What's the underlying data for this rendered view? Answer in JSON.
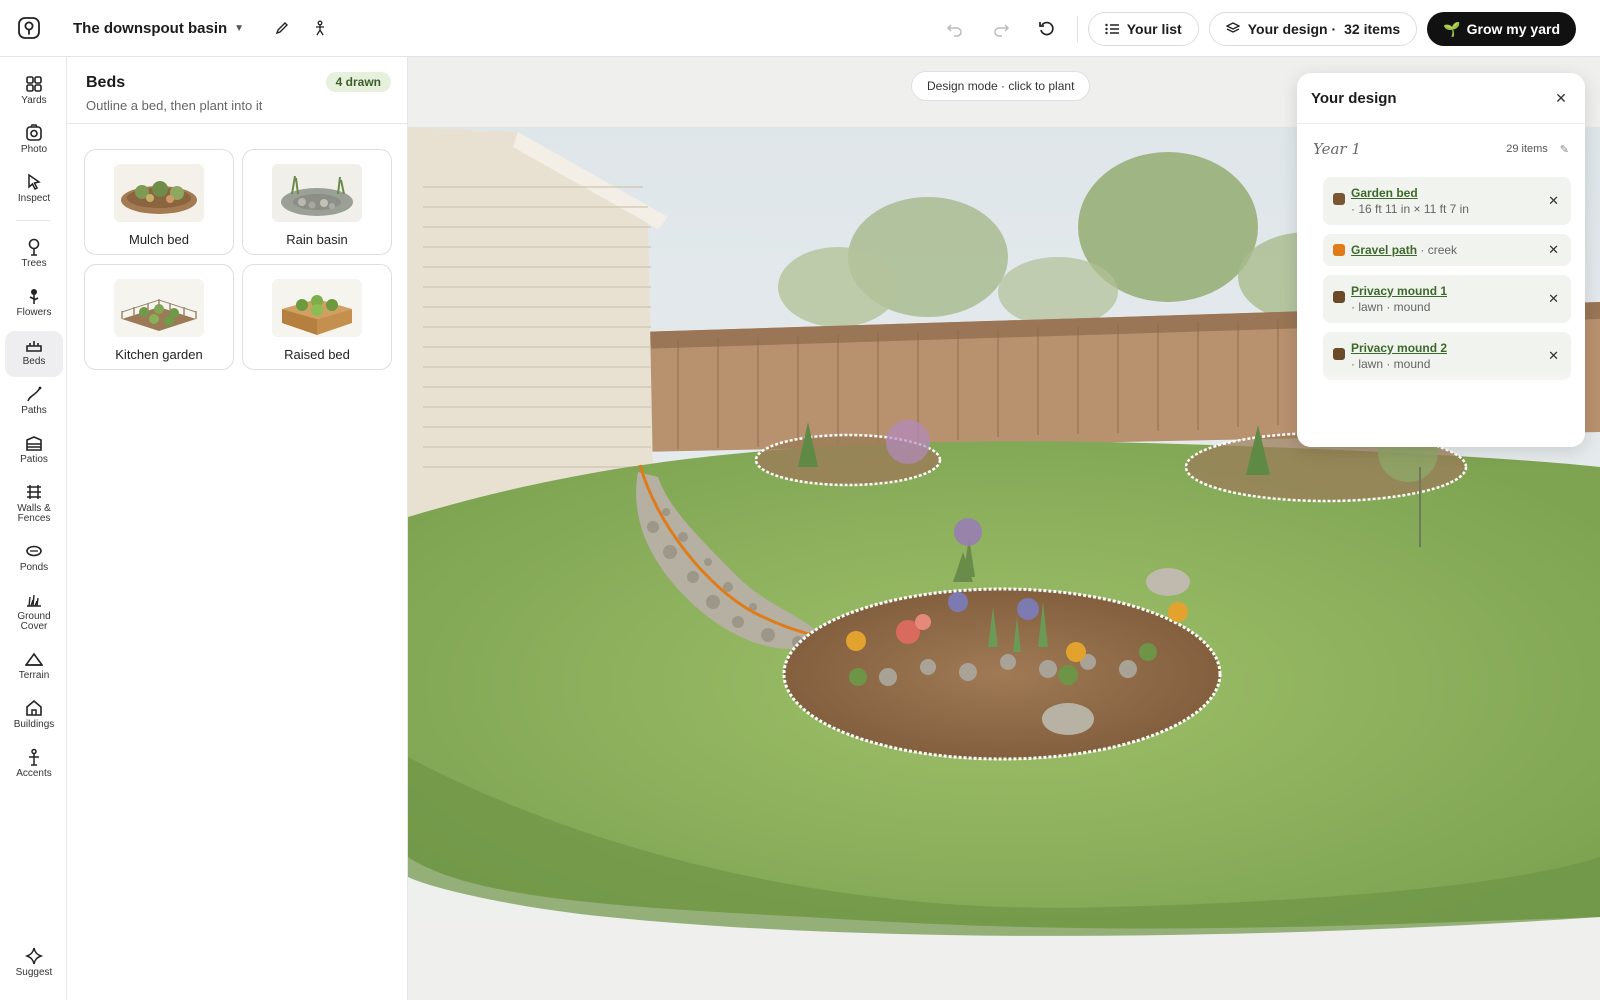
{
  "header": {
    "project_name": "The downspout basin",
    "your_list": "Your list",
    "your_design_label": "Your design ·",
    "your_design_count": "32 items",
    "cta": "Grow my yard",
    "cta_icon": "🌱"
  },
  "rail": {
    "items": [
      {
        "label": "Yards",
        "icon": "grid-icon"
      },
      {
        "label": "Photo",
        "icon": "camera-icon"
      },
      {
        "label": "Inspect",
        "icon": "pointer-icon"
      },
      {
        "label": "Trees",
        "icon": "tree-icon"
      },
      {
        "label": "Flowers",
        "icon": "flower-icon"
      },
      {
        "label": "Beds",
        "icon": "bed-icon"
      },
      {
        "label": "Paths",
        "icon": "path-icon"
      },
      {
        "label": "Patios",
        "icon": "patio-icon"
      },
      {
        "label": "Walls &",
        "label2": "Fences",
        "icon": "fence-icon"
      },
      {
        "label": "Ponds",
        "icon": "pond-icon"
      },
      {
        "label": "Ground",
        "label2": "Cover",
        "icon": "groundcover-icon"
      },
      {
        "label": "Terrain",
        "icon": "terrain-icon"
      },
      {
        "label": "Buildings",
        "icon": "house-icon"
      },
      {
        "label": "Accents",
        "icon": "accent-icon"
      },
      {
        "label": "Suggest",
        "icon": "sparkle-icon"
      }
    ],
    "active": "Beds"
  },
  "panel": {
    "title": "Beds",
    "subtitle": "Outline a bed, then plant into it",
    "badge": "4 drawn",
    "cards": [
      {
        "label": "Mulch bed"
      },
      {
        "label": "Rain basin"
      },
      {
        "label": "Kitchen garden"
      },
      {
        "label": "Raised bed"
      }
    ]
  },
  "canvas": {
    "mode_chip": "Design mode · click to plant"
  },
  "design": {
    "title": "Your design",
    "year": "Year 1",
    "count": "29 items",
    "rows": [
      {
        "name": "Garden bed",
        "detail": "· 16 ft 11 in × 11 ft 7 in",
        "color": "#7a5634"
      },
      {
        "name": "Gravel path",
        "detail": "· creek",
        "color": "#e07b1a"
      },
      {
        "name": "Privacy mound 1",
        "detail": "· lawn · mound",
        "color": "#6b4a2a"
      },
      {
        "name": "Privacy mound 2",
        "detail": "· lawn · mound",
        "color": "#6b4a2a"
      }
    ]
  },
  "colors": {
    "accent_green": "#3d6a2c",
    "cta_bg": "#111111",
    "badge_bg": "#e6f0dc",
    "creek_line": "#e07b1a"
  }
}
